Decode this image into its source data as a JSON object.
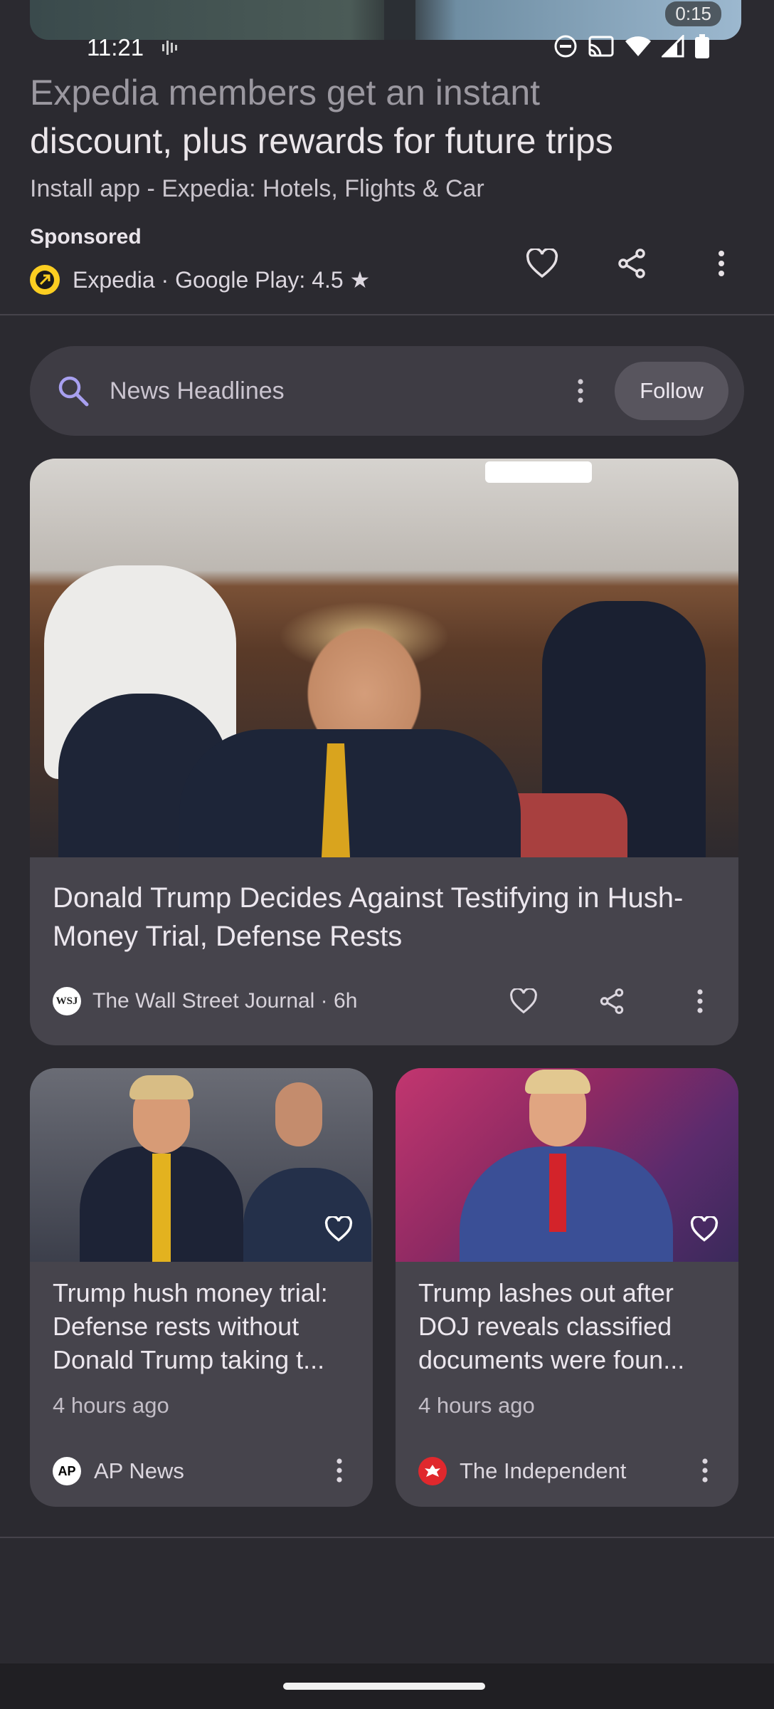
{
  "video": {
    "duration": "0:15"
  },
  "status_bar": {
    "time": "11:21"
  },
  "ad": {
    "title_line1": "Expedia members get an instant",
    "title_line2": "discount, plus rewards for future trips",
    "subtitle": "Install app - Expedia: Hotels, Flights & Car",
    "sponsored_label": "Sponsored",
    "source": "Expedia · Google Play: 4.5 ★"
  },
  "search": {
    "query": "News Headlines",
    "follow_label": "Follow"
  },
  "feature_story": {
    "title": "Donald Trump Decides Against Testifying in Hush-Money Trial, Defense Rests",
    "source": "The Wall Street Journal · 6h",
    "source_logo": "WSJ"
  },
  "stories": [
    {
      "title": "Trump hush money trial: Defense rests without Donald Trump taking t...",
      "time": "4 hours ago",
      "source": "AP News",
      "source_logo": "AP"
    },
    {
      "title": "Trump lashes out after DOJ reveals classified documents were foun...",
      "time": "4 hours ago",
      "source": "The Independent"
    }
  ],
  "colors": {
    "background": "#2b2a30",
    "card": "#46444c",
    "search_accent": "#a8a0f0",
    "expedia_yellow": "#fbce21",
    "independent_red": "#e0282d"
  }
}
